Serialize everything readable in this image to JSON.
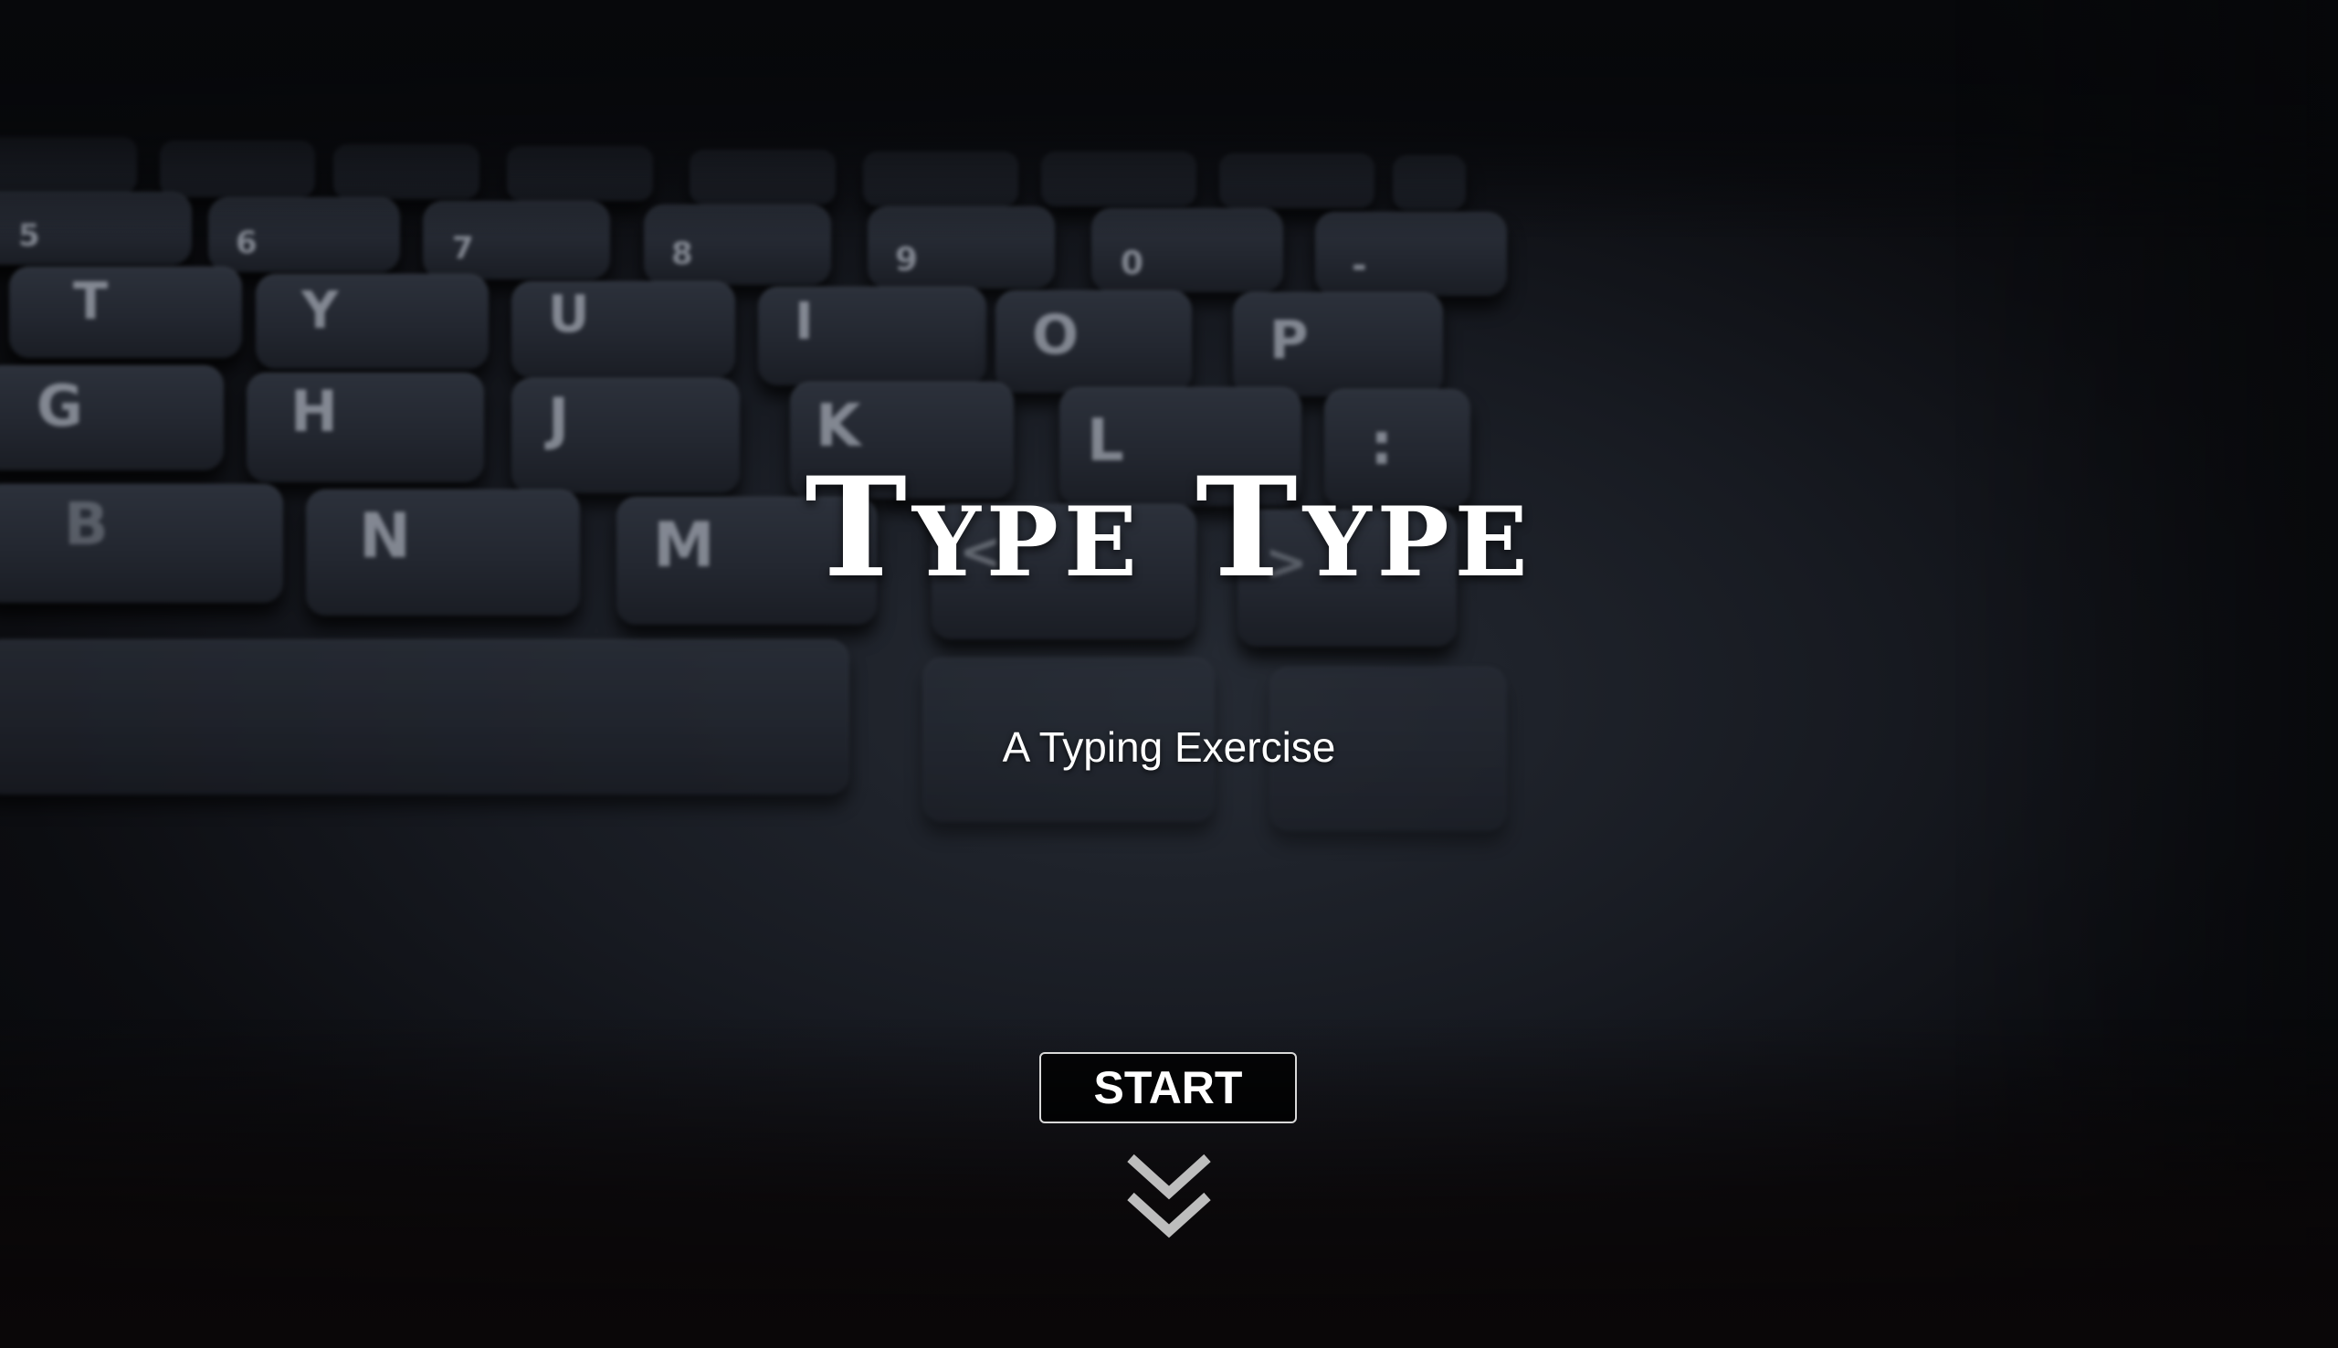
{
  "hero": {
    "title": "Type Type",
    "subtitle": "A Typing Exercise"
  },
  "actions": {
    "start_label": "START"
  },
  "icons": {
    "scroll_down": "double-chevron-down-icon"
  },
  "colors": {
    "text": "#ffffff",
    "button_border": "#d9d9d9",
    "chevron": "#bdbdbd"
  },
  "background": {
    "key_rows": [
      [
        "5",
        "6",
        "7",
        "8",
        "9",
        "0",
        "-"
      ],
      [
        "T",
        "Y",
        "U",
        "I",
        "O",
        "P"
      ],
      [
        "G",
        "H",
        "J",
        "K",
        "L",
        ":"
      ],
      [
        "B",
        "N",
        "M",
        "<",
        ">"
      ]
    ]
  }
}
